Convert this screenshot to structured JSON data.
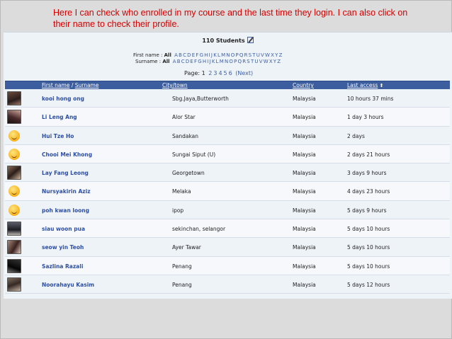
{
  "caption": "Here I can check who enrolled in my course and the last time they login. I can also click on their name to check their profile.",
  "header": {
    "count_label": "110 Students",
    "edit_icon": "edit-icon"
  },
  "filters": {
    "first_name_label": "First name :",
    "surname_label": "Surname :",
    "all_label": "All",
    "letters": [
      "A",
      "B",
      "C",
      "D",
      "E",
      "F",
      "G",
      "H",
      "I",
      "J",
      "K",
      "L",
      "M",
      "N",
      "O",
      "P",
      "Q",
      "R",
      "S",
      "T",
      "U",
      "V",
      "W",
      "X",
      "Y",
      "Z"
    ]
  },
  "pager": {
    "label": "Page:",
    "current": "1",
    "pages": [
      "2",
      "3",
      "4",
      "5",
      "6"
    ],
    "next": "(Next)"
  },
  "columns": {
    "first_name": "First name",
    "separator": " / ",
    "surname": "Surname",
    "city": "City/town",
    "country": "Country",
    "last_access": "Last access",
    "sort_icon": "sort-arrow-up-icon"
  },
  "rows": [
    {
      "name": "kooi hong ong",
      "city": "Sbg.Jaya,Butterworth",
      "country": "Malaysia",
      "last_access": "10 hours 37 mins",
      "avatar": "photo"
    },
    {
      "name": "Li Leng Ang",
      "city": "Alor Star",
      "country": "Malaysia",
      "last_access": "1 day 3 hours",
      "avatar": "photo"
    },
    {
      "name": "Hui Tze Ho",
      "city": "Sandakan",
      "country": "Malaysia",
      "last_access": "2 days",
      "avatar": "smiley"
    },
    {
      "name": "Chooi Mei Khong",
      "city": "Sungai Siput (U)",
      "country": "Malaysia",
      "last_access": "2 days 21 hours",
      "avatar": "smiley"
    },
    {
      "name": "Lay Fang Leong",
      "city": "Georgetown",
      "country": "Malaysia",
      "last_access": "3 days 9 hours",
      "avatar": "photo"
    },
    {
      "name": "Nursyakirin Aziz",
      "city": "Melaka",
      "country": "Malaysia",
      "last_access": "4 days 23 hours",
      "avatar": "smiley"
    },
    {
      "name": "poh kwan loong",
      "city": "ipop",
      "country": "Malaysia",
      "last_access": "5 days 9 hours",
      "avatar": "smiley"
    },
    {
      "name": "siau woon pua",
      "city": "sekinchan, selangor",
      "country": "Malaysia",
      "last_access": "5 days 10 hours",
      "avatar": "photo"
    },
    {
      "name": "seow yin Teoh",
      "city": "Ayer Tawar",
      "country": "Malaysia",
      "last_access": "5 days 10 hours",
      "avatar": "photo"
    },
    {
      "name": "Sazlina Razali",
      "city": "Penang",
      "country": "Malaysia",
      "last_access": "5 days 10 hours",
      "avatar": "photo"
    },
    {
      "name": "Noorahayu Kasim",
      "city": "Penang",
      "country": "Malaysia",
      "last_access": "5 days 12 hours",
      "avatar": "photo"
    }
  ]
}
